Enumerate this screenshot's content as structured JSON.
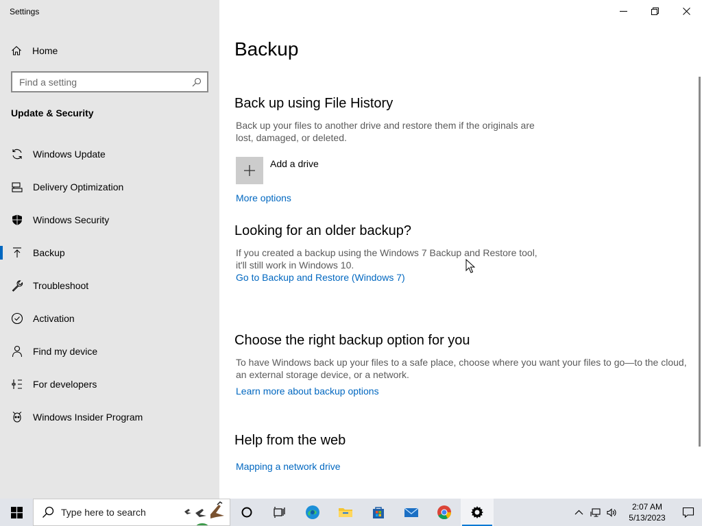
{
  "window": {
    "app_title": "Settings"
  },
  "sidebar": {
    "home_label": "Home",
    "search_placeholder": "Find a setting",
    "section_title": "Update & Security",
    "items": [
      {
        "label": "Windows Update",
        "icon": "refresh-icon"
      },
      {
        "label": "Delivery Optimization",
        "icon": "delivery-icon"
      },
      {
        "label": "Windows Security",
        "icon": "shield-icon"
      },
      {
        "label": "Backup",
        "icon": "backup-icon",
        "active": true
      },
      {
        "label": "Troubleshoot",
        "icon": "wrench-icon"
      },
      {
        "label": "Activation",
        "icon": "check-circle-icon"
      },
      {
        "label": "Find my device",
        "icon": "person-icon"
      },
      {
        "label": "For developers",
        "icon": "developer-icon"
      },
      {
        "label": "Windows Insider Program",
        "icon": "insider-icon"
      }
    ]
  },
  "main": {
    "title": "Backup",
    "file_history": {
      "heading": "Back up using File History",
      "description": "Back up your files to another drive and restore them if the originals are lost, damaged, or deleted.",
      "add_drive_label": "Add a drive",
      "more_options": "More options"
    },
    "older_backup": {
      "heading": "Looking for an older backup?",
      "description": "If you created a backup using the Windows 7 Backup and Restore tool, it'll still work in Windows 10.",
      "link": "Go to Backup and Restore (Windows 7)"
    },
    "choose_option": {
      "heading": "Choose the right backup option for you",
      "description": "To have Windows back up your files to a safe place, choose where you want your files to go—to the cloud, an external storage device, or a network.",
      "link": "Learn more about backup options"
    },
    "help": {
      "heading": "Help from the web",
      "link": "Mapping a network drive"
    }
  },
  "taskbar": {
    "search_placeholder": "Type here to search",
    "time": "2:07 AM",
    "date": "5/13/2023",
    "accent": "#0078d4"
  },
  "colors": {
    "link": "#0067c0",
    "sidebar_bg": "#e6e6e6",
    "taskbar_bg": "#e1e4ea"
  }
}
